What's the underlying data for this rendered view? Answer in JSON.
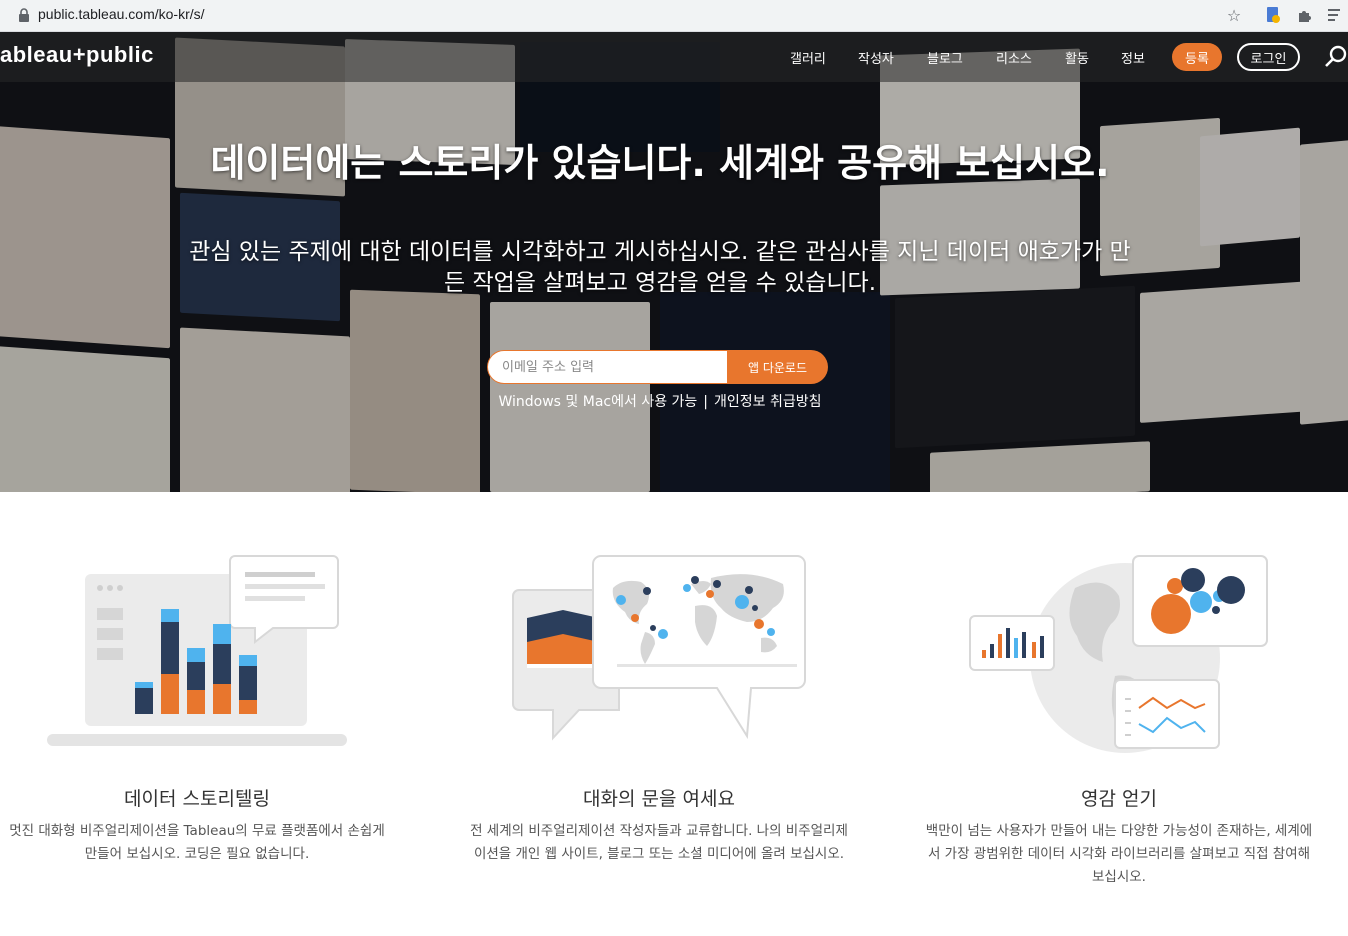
{
  "browser": {
    "url": "public.tableau.com/ko-kr/s/"
  },
  "nav": {
    "logo_text": "ableau+public",
    "items": [
      {
        "label": "갤러리"
      },
      {
        "label": "작성자"
      },
      {
        "label": "블로그"
      },
      {
        "label": "리소스"
      },
      {
        "label": "활동"
      },
      {
        "label": "정보"
      }
    ],
    "register_label": "등록",
    "login_label": "로그인"
  },
  "hero": {
    "headline": "데이터에는 스토리가 있습니다. 세계와 공유해 보십시오.",
    "subline": "관심 있는 주제에 대한 데이터를 시각화하고 게시하십시오. 같은 관심사를 지닌 데이터 애호가가 만든 작업을 살펴보고 영감을 얻을 수 있습니다.",
    "email_placeholder": "이메일 주소 입력",
    "download_label": "앱 다운로드",
    "availability_text": "Windows 및 Mac에서 사용 가능",
    "separator": "|",
    "privacy_label": "개인정보 취급방침"
  },
  "features": [
    {
      "title": "데이터 스토리텔링",
      "description": "멋진 대화형 비주얼리제이션을 Tableau의 무료 플랫폼에서 손쉽게 만들어 보십시오. 코딩은 필요 없습니다."
    },
    {
      "title": "대화의 문을 여세요",
      "description": "전 세계의 비주얼리제이션 작성자들과 교류합니다. 나의 비주얼리제이션을 개인 웹 사이트, 블로그 또는 소셜 미디어에 올려 보십시오."
    },
    {
      "title": "영감 얻기",
      "description": "백만이 넘는 사용자가 만들어 내는 다양한 가능성이 존재하는, 세계에서 가장 광범위한 데이터 시각화 라이브러리를 살펴보고 직접 참여해 보십시오."
    }
  ],
  "colors": {
    "accent_orange": "#e8762d",
    "navy": "#2b3e5c",
    "light_blue": "#4fb3ee"
  }
}
